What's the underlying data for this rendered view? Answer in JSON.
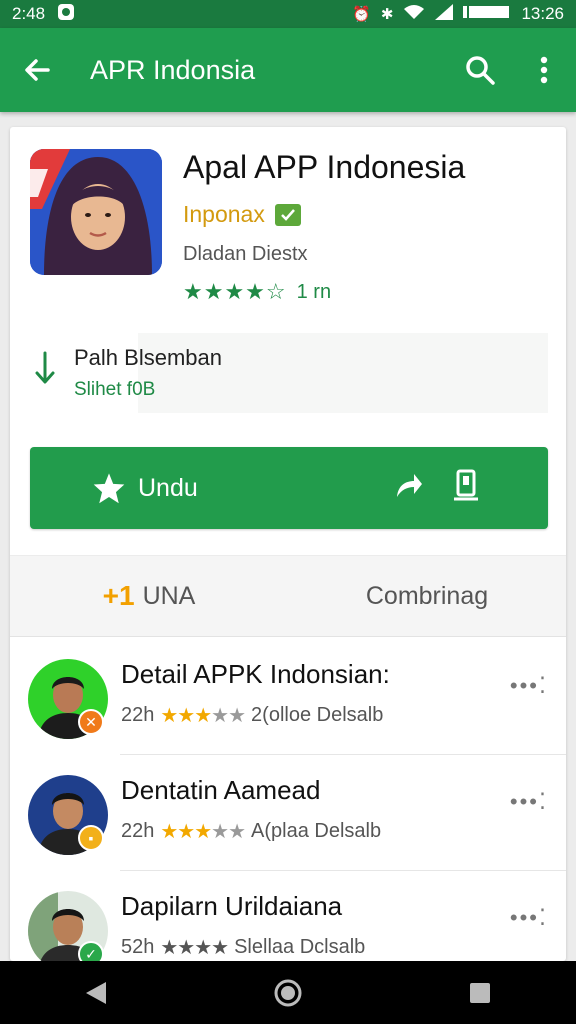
{
  "status_bar": {
    "time_left": "2:48",
    "time_right": "13:26"
  },
  "app_bar": {
    "title": "APR Indonsia"
  },
  "app": {
    "name": "Apal APP Indonesia",
    "developer": "Inponax",
    "category": "Dladan Diestx",
    "rating_count": "1 rn"
  },
  "download": {
    "title": "Palh Blsemban",
    "size": "Slihet f0B"
  },
  "install_button": {
    "label": "Undu"
  },
  "tabs": [
    {
      "prefix": "+1",
      "label": "UNA"
    },
    {
      "label": "Combrinag"
    }
  ],
  "reviews": [
    {
      "title": "Detail APPK Indonsian:",
      "count": "22h",
      "stars_on": 3,
      "meta": "2(olloe Delsalb"
    },
    {
      "title": "Dentatin Aamead",
      "count": "22h",
      "stars_on": 3,
      "meta": "A(plaa Delsalb"
    },
    {
      "title": "Dapilarn Urildaiana",
      "count": "52h",
      "stars_on": 0,
      "meta": "Slellaa Dclsalb"
    }
  ],
  "colors": {
    "status_bar": "#1a7a3f",
    "app_bar": "#1f9d4f",
    "install_button": "#229c4c",
    "accent_green": "#1f8a46",
    "star_yellow": "#f2a800",
    "developer_gold": "#d39a0f"
  },
  "icons": [
    "back-arrow-icon",
    "search-icon",
    "more-vert-icon",
    "download-icon",
    "star-icon",
    "share-icon",
    "wishlist-icon",
    "more-horiz-icon",
    "nav-back-icon",
    "nav-home-icon",
    "nav-recents-icon"
  ]
}
